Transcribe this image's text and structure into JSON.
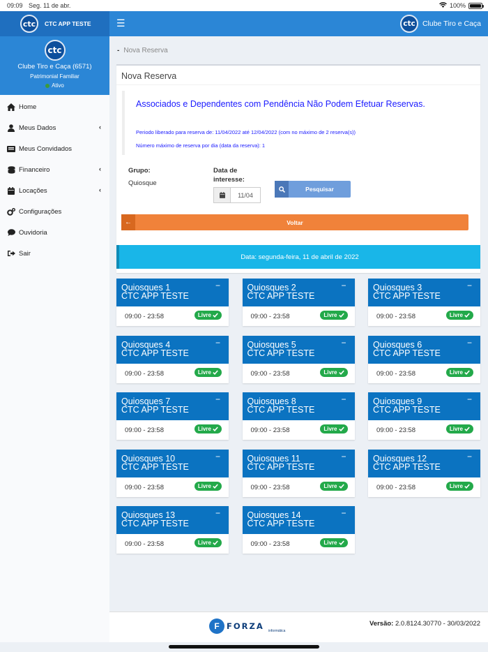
{
  "status_bar": {
    "time": "09:09",
    "date": "Seg. 11 de abr.",
    "battery": "100%"
  },
  "brand": {
    "logo_text": "ctc",
    "app_name": "CTC APP TESTE"
  },
  "navbar": {
    "club_name": "Clube Tiro e Caça"
  },
  "user": {
    "name": "Clube Tiro e Caça (6571)",
    "category": "Patrimonial Familiar",
    "status": "Ativo"
  },
  "menu": [
    {
      "label": "Home",
      "icon": "home-icon"
    },
    {
      "label": "Meus Dados",
      "icon": "user-icon",
      "has_submenu": true
    },
    {
      "label": "Meus Convidados",
      "icon": "id-card-icon"
    },
    {
      "label": "Financeiro",
      "icon": "coins-icon",
      "has_submenu": true
    },
    {
      "label": "Locações",
      "icon": "calendar-icon",
      "has_submenu": true
    },
    {
      "label": "Configurações",
      "icon": "gears-icon"
    },
    {
      "label": "Ouvidoria",
      "icon": "comment-icon"
    },
    {
      "label": "Sair",
      "icon": "sign-out-icon"
    }
  ],
  "breadcrumb": {
    "separator": "-",
    "current": "Nova Reserva"
  },
  "panel": {
    "title": "Nova Reserva",
    "notice_heading": "Associados e Dependentes com Pendência Não Podem Efetuar Reservas.",
    "notice_period": "Periodo liberado para reserva de: 11/04/2022 até 12/04/2022 (com no máximo de 2 reserva(s))",
    "notice_max": "Número máximo de reserva por dia (data da reserva): 1",
    "group_label": "Grupo:",
    "group_value": "Quiosque",
    "date_label_1": "Data de",
    "date_label_2": "interesse:",
    "date_value": "11/04",
    "search_label": "Pesquisar",
    "back_label": "Voltar"
  },
  "date_bar": "Data: segunda-feira, 11 de abril de 2022",
  "kiosks": [
    {
      "name": "Quiosques 1",
      "sub": "CTC APP TESTE",
      "time": "09:00 - 23:58",
      "status": "Livre"
    },
    {
      "name": "Quiosques 2",
      "sub": "CTC APP TESTE",
      "time": "09:00 - 23:58",
      "status": "Livre"
    },
    {
      "name": "Quiosques 3",
      "sub": "CTC APP TESTE",
      "time": "09:00 - 23:58",
      "status": "Livre"
    },
    {
      "name": "Quiosques 4",
      "sub": "CTC APP TESTE",
      "time": "09:00 - 23:58",
      "status": "Livre"
    },
    {
      "name": "Quiosques 5",
      "sub": "CTC APP TESTE",
      "time": "09:00 - 23:58",
      "status": "Livre"
    },
    {
      "name": "Quiosques 6",
      "sub": "CTC APP TESTE",
      "time": "09:00 - 23:58",
      "status": "Livre"
    },
    {
      "name": "Quiosques 7",
      "sub": "CTC APP TESTE",
      "time": "09:00 - 23:58",
      "status": "Livre"
    },
    {
      "name": "Quiosques 8",
      "sub": "CTC APP TESTE",
      "time": "09:00 - 23:58",
      "status": "Livre"
    },
    {
      "name": "Quiosques 9",
      "sub": "CTC APP TESTE",
      "time": "09:00 - 23:58",
      "status": "Livre"
    },
    {
      "name": "Quiosques 10",
      "sub": "CTC APP TESTE",
      "time": "09:00 - 23:58",
      "status": "Livre"
    },
    {
      "name": "Quiosques 11",
      "sub": "CTC APP TESTE",
      "time": "09:00 - 23:58",
      "status": "Livre"
    },
    {
      "name": "Quiosques 12",
      "sub": "CTC APP TESTE",
      "time": "09:00 - 23:58",
      "status": "Livre"
    },
    {
      "name": "Quiosques 13",
      "sub": "CTC APP TESTE",
      "time": "09:00 - 23:58",
      "status": "Livre"
    },
    {
      "name": "Quiosques 14",
      "sub": "CTC APP TESTE",
      "time": "09:00 - 23:58",
      "status": "Livre"
    }
  ],
  "footer": {
    "brand": "FORZA",
    "brand_sub": "informática",
    "version_label": "Versão:",
    "version_value": "2.0.8124.30770 - 30/03/2022"
  },
  "colors": {
    "sidebar_header": "#2b86d6",
    "kiosk_header": "#0b73c1",
    "badge_free": "#23a94a",
    "back_button": "#f0823a",
    "date_bar": "#19b6e8"
  }
}
